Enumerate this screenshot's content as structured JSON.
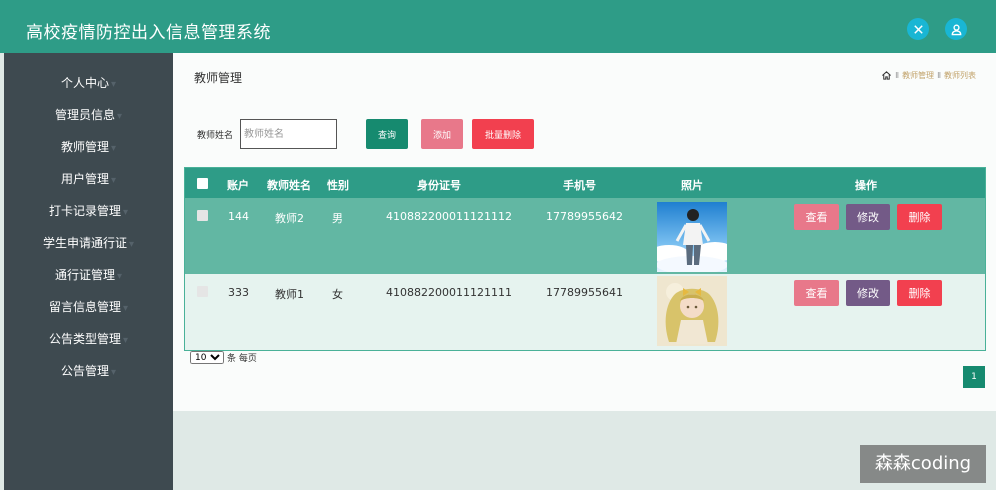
{
  "header": {
    "title": "高校疫情防控出入信息管理系统"
  },
  "sidebar": {
    "items": [
      {
        "label": "个人中心"
      },
      {
        "label": "管理员信息"
      },
      {
        "label": "教师管理"
      },
      {
        "label": "用户管理"
      },
      {
        "label": "打卡记录管理"
      },
      {
        "label": "学生申请通行证"
      },
      {
        "label": "通行证管理"
      },
      {
        "label": "留言信息管理"
      },
      {
        "label": "公告类型管理"
      },
      {
        "label": "公告管理"
      }
    ]
  },
  "page": {
    "title": "教师管理",
    "breadcrumb": [
      "教师管理",
      "教师列表"
    ]
  },
  "search": {
    "label": "教师姓名",
    "placeholder": "教师姓名",
    "search_btn": "查询",
    "add_btn": "添加",
    "batch_delete_btn": "批量删除"
  },
  "table": {
    "headers": [
      "账户",
      "教师姓名",
      "性别",
      "身份证号",
      "手机号",
      "照片",
      "操作"
    ],
    "rows": [
      {
        "account": "144",
        "name": "教师2",
        "gender": "男",
        "id_card": "410882200011121112",
        "phone": "17789955642",
        "photo": "boy-photo"
      },
      {
        "account": "333",
        "name": "教师1",
        "gender": "女",
        "id_card": "410882200011121111",
        "phone": "17789955641",
        "photo": "girl-photo"
      }
    ],
    "actions": {
      "view": "查看",
      "edit": "修改",
      "delete": "删除"
    }
  },
  "pagination": {
    "page_size": "10",
    "page_size_options": [
      "10"
    ],
    "per_page_label": "条 每页",
    "current_page": "1"
  },
  "watermark": "森森coding",
  "colors": {
    "primary": "#2e9c87",
    "sidebar": "#3e4a50",
    "danger": "#f2404f",
    "pink": "#e8788a",
    "purple": "#735a87"
  }
}
